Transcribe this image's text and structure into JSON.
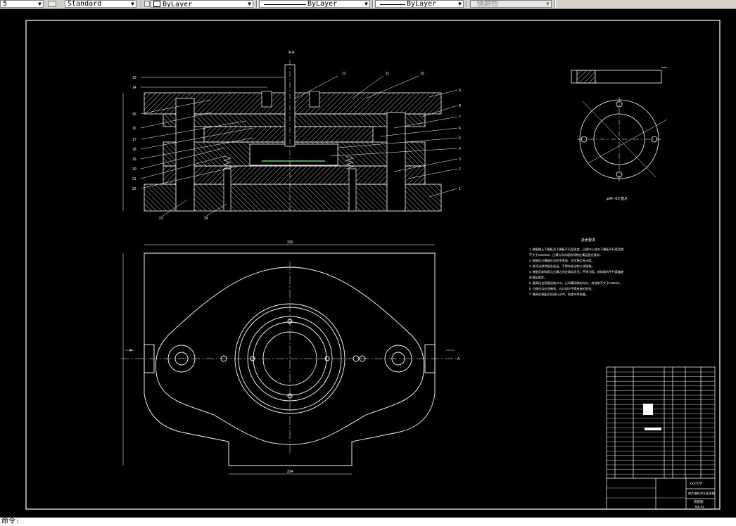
{
  "toolbar": {
    "left_stub": "5",
    "text_style": "Standard",
    "layer": "ByLayer",
    "linetype": "ByLayer",
    "lineweight": "ByLayer",
    "plot_style": "随颜色"
  },
  "drawing": {
    "section_label": "A-A",
    "bottom_width": "320",
    "bottom_base": "224",
    "gasket_label": "φ94 ×10 垫片",
    "tech_req_title": "技术要求",
    "tech_req_lines": [
      "1. 装配模上下模板及下模板平行度误差，凸模中心线对下模板平行度误差",
      "   不大于0.05/100，凸模与导向板的间隙应满足配合要求。",
      "2. 装配后凸模能在导柱中滑动，灵活稳定无卡阻。",
      "3. 各活动部件配合适当，不得有松动和卡滞现象。",
      "4. 装配后卸料板与凸模之间应滑动灵活，不得卡阻，卸料板的平行度偏差",
      "   应满足要求。",
      "5. 模具闭合高度误差±0.5，凸凹模间隙应均匀，其误差不大于0.05mm。",
      "6. 凸模刃口必须锋利，刃口部分不得有崩刃损伤。",
      "7. 模具在装配后应进行试冲，检查冲件质量。"
    ],
    "section_marks": [
      "A",
      "A"
    ],
    "part_callouts": [
      "13",
      "14",
      "12",
      "11",
      "10",
      "9",
      "8",
      "7",
      "6",
      "5",
      "4",
      "3",
      "2",
      "1",
      "15",
      "16",
      "17",
      "18",
      "19",
      "20",
      "21",
      "22",
      "23",
      "24"
    ],
    "title_block": {
      "school": "XXX大学",
      "title": "垫片落料冲孔复合模",
      "drawing_type": "装配图",
      "code": "ML-01"
    }
  },
  "status": {
    "command_line": "命令:"
  }
}
